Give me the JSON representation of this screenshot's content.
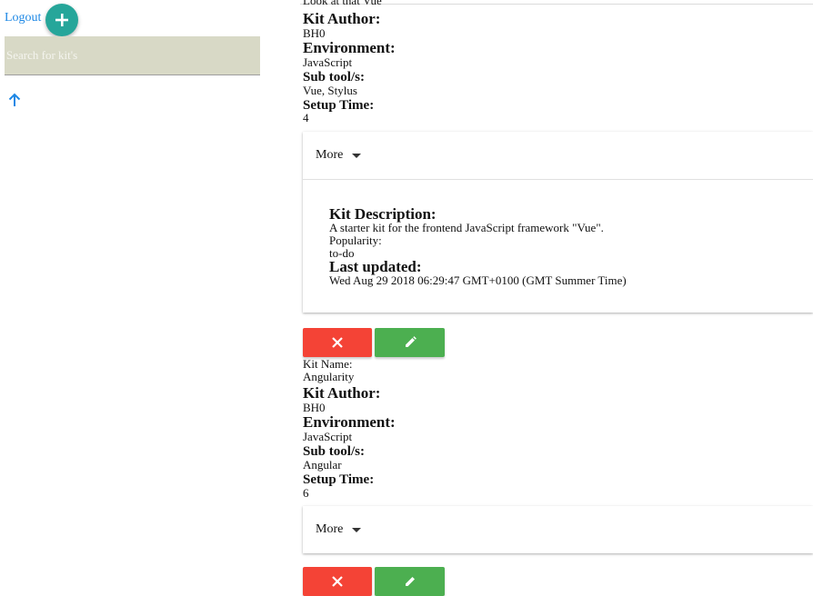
{
  "header": {
    "logout_label": "Logout"
  },
  "search": {
    "placeholder": "Search for kit's"
  },
  "kits": [
    {
      "partial_name": "Look at that Vue",
      "author_label": "Kit Author:",
      "author": "BH0",
      "environment_label": "Environment:",
      "environment": "JavaScript",
      "subtools_label": "Sub tool/s:",
      "subtools": "Vue, Stylus",
      "setup_label": "Setup Time:",
      "setup": "4",
      "more_label": "More",
      "description_label": "Kit Description:",
      "description": "A starter kit for the frontend JavaScript framework \"Vue\".",
      "popularity_label": "Popularity:",
      "popularity": "to-do",
      "updated_label": "Last updated:",
      "updated": "Wed Aug 29 2018 06:29:47 GMT+0100 (GMT Summer Time)"
    },
    {
      "name_label": "Kit Name:",
      "name": "Angularity",
      "author_label": "Kit Author:",
      "author": "BH0",
      "environment_label": "Environment:",
      "environment": "JavaScript",
      "subtools_label": "Sub tool/s:",
      "subtools": "Angular",
      "setup_label": "Setup Time:",
      "setup": "6",
      "more_label": "More"
    }
  ],
  "colors": {
    "accent_fab": "#26a69a",
    "delete": "#f44336",
    "edit": "#4caf50",
    "link": "#1e88e5"
  }
}
